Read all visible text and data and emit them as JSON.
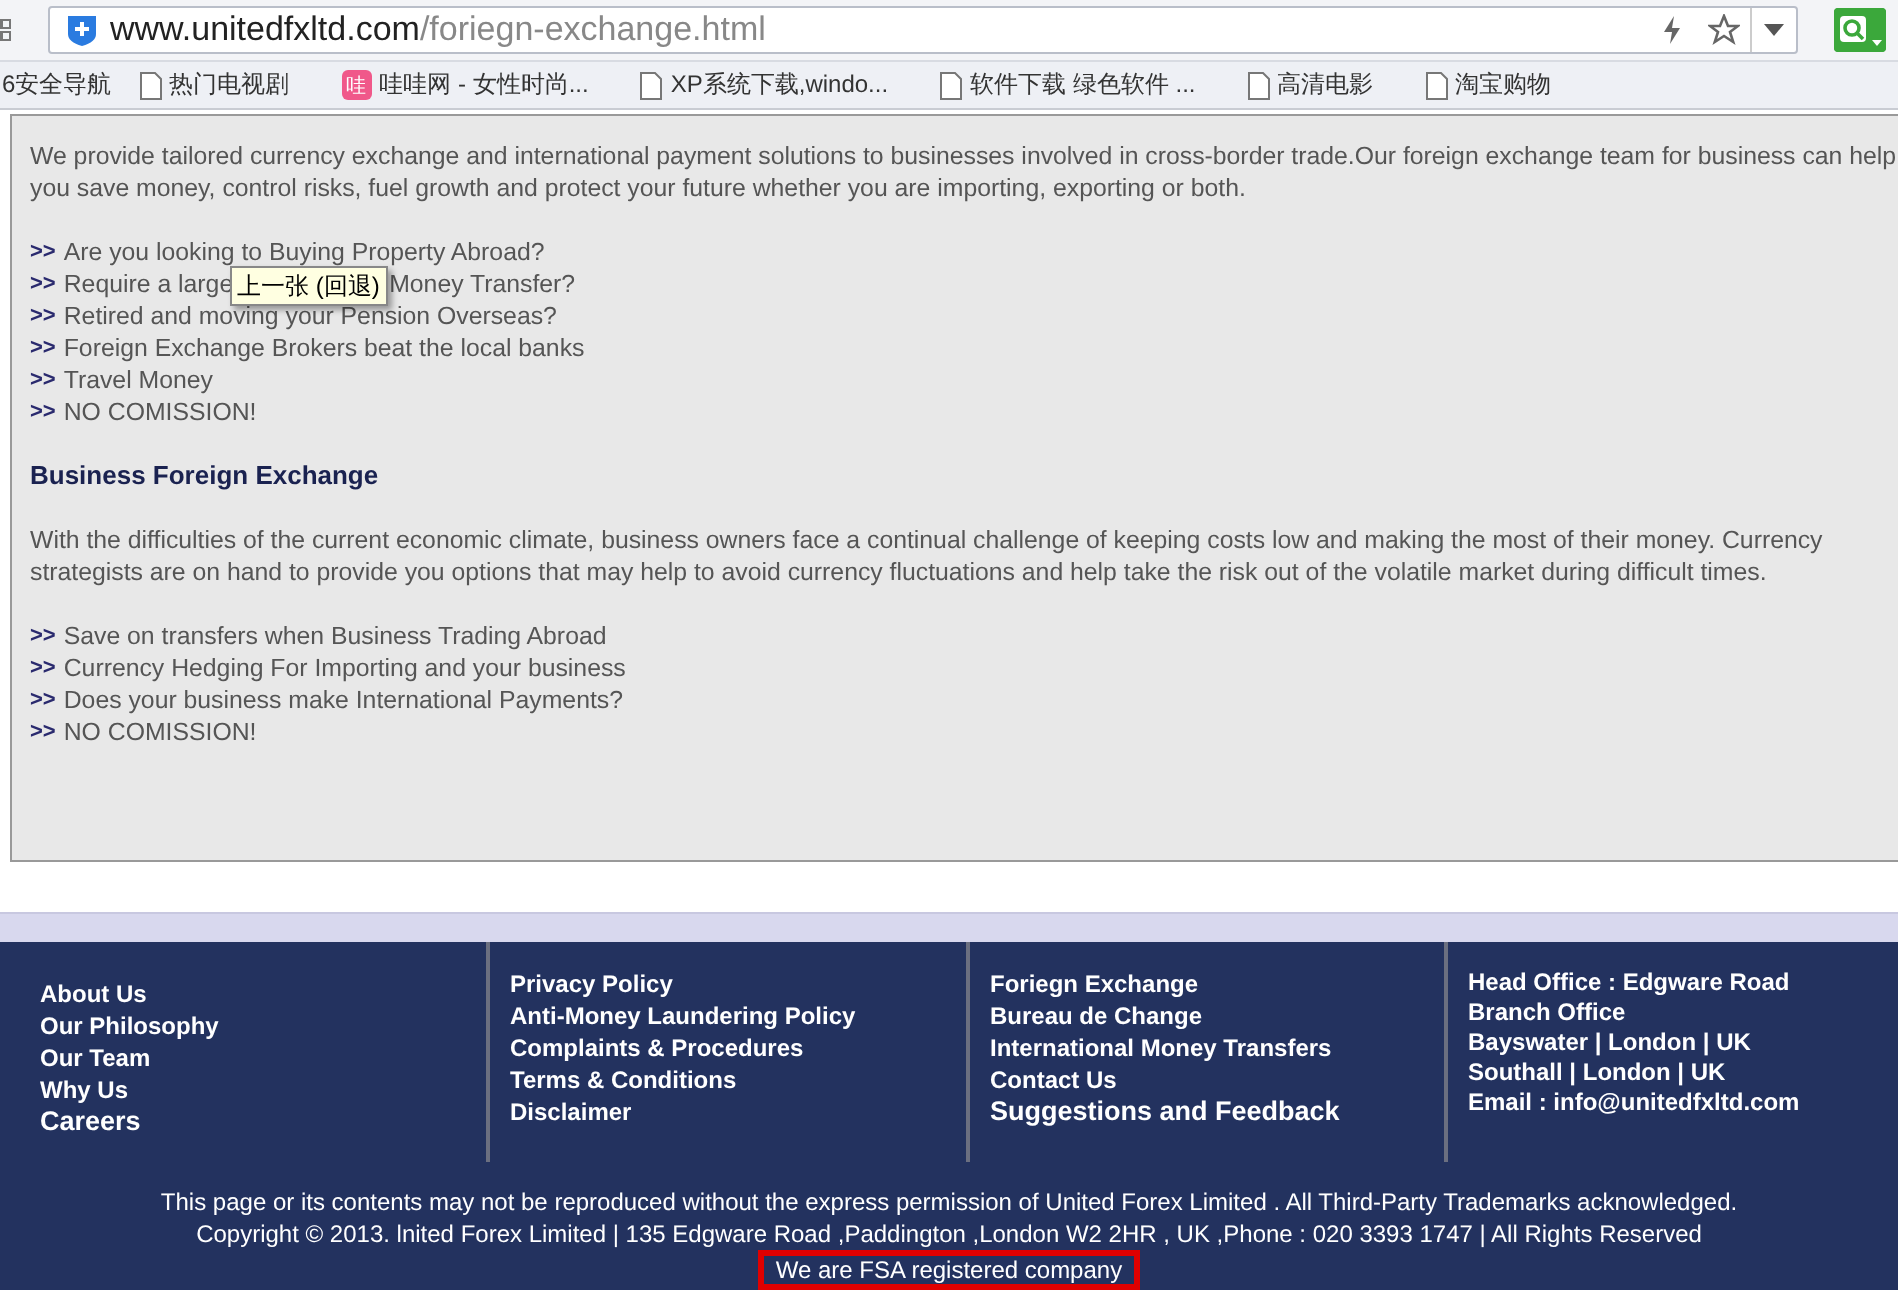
{
  "browser": {
    "url_host": "www.unitedfxltd.com",
    "url_path": "/foriegn-exchange.html",
    "bookmarks": [
      {
        "label": "6安全导航",
        "kind": "plain"
      },
      {
        "label": "热门电视剧",
        "kind": "page"
      },
      {
        "label": "哇哇网 - 女性时尚...",
        "kind": "badge",
        "badge": "哇"
      },
      {
        "label": "XP系统下载,windo...",
        "kind": "page"
      },
      {
        "label": "软件下载 绿色软件 ...",
        "kind": "page"
      },
      {
        "label": "高清电影",
        "kind": "page"
      },
      {
        "label": "淘宝购物",
        "kind": "page"
      }
    ]
  },
  "content": {
    "intro": "We provide tailored currency exchange and international payment solutions to businesses involved in cross-border trade.Our foreign exchange team for business can help you save money, control risks, fuel growth and protect your future whether you are importing, exporting or both.",
    "list_1": [
      {
        "bullet": ">>",
        "parts": [
          "Are you looking to Buying Property Abroad?"
        ]
      },
      {
        "bullet": ">>",
        "parts": [
          "Require a large",
          "Money Transfer?"
        ]
      },
      {
        "bullet": ">>",
        "parts": [
          "Retired and moving your Pension Overseas?"
        ]
      },
      {
        "bullet": ">>",
        "parts": [
          "Foreign Exchange Brokers beat the local banks"
        ]
      },
      {
        "bullet": ">>",
        "parts": [
          "Travel Money"
        ]
      },
      {
        "bullet": ">>",
        "parts": [
          "NO COMISSION!"
        ]
      }
    ],
    "heading": "Business Foreign Exchange",
    "body": "With the difficulties of the current economic climate, business owners face a continual challenge of keeping costs low and making the most of their money. Currency strategists are on hand to provide you options that may help to avoid currency fluctuations and help take the risk out of the volatile market during difficult times.",
    "list_2": [
      {
        "bullet": ">>",
        "parts": [
          "Save on transfers when Business Trading Abroad"
        ]
      },
      {
        "bullet": ">>",
        "parts": [
          "Currency Hedging For Importing and your business"
        ]
      },
      {
        "bullet": ">>",
        "parts": [
          "Does your business make International Payments?"
        ]
      },
      {
        "bullet": ">>",
        "parts": [
          "NO COMISSION!"
        ]
      }
    ]
  },
  "tooltip": {
    "text": "上一张 (回退)"
  },
  "footer": {
    "columns": [
      {
        "items": [
          {
            "text": "About Us",
            "kind": "link"
          },
          {
            "text": "Our Philosophy",
            "kind": "link"
          },
          {
            "text": "Our Team",
            "kind": "link"
          },
          {
            "text": "Why Us",
            "kind": "link"
          },
          {
            "text": "Careers",
            "kind": "large"
          }
        ]
      },
      {
        "items": [
          {
            "text": "Privacy Policy",
            "kind": "link"
          },
          {
            "text": "Anti-Money Laundering Policy",
            "kind": "link"
          },
          {
            "text": "Complaints & Procedures",
            "kind": "link"
          },
          {
            "text": "Terms & Conditions",
            "kind": "link"
          },
          {
            "text": "Disclaimer",
            "kind": "link"
          }
        ]
      },
      {
        "items": [
          {
            "text": "Foriegn Exchange",
            "kind": "link"
          },
          {
            "text": "Bureau de Change",
            "kind": "link"
          },
          {
            "text": "International Money Transfers",
            "kind": "link"
          },
          {
            "text": "Contact Us",
            "kind": "link"
          },
          {
            "text": "Suggestions and Feedback",
            "kind": "large"
          }
        ]
      },
      {
        "items": [
          {
            "text": "Head Office : Edgware Road",
            "kind": "info"
          },
          {
            "text": "Branch Office",
            "kind": "info"
          },
          {
            "text": "Bayswater | London | UK",
            "kind": "info"
          },
          {
            "text": "Southall | London | UK",
            "kind": "info"
          },
          {
            "text": "Email : info@unitedfxltd.com",
            "kind": "info"
          }
        ]
      }
    ],
    "notice": "This page or its contents may not be reproduced without the express permission of United Forex Limited . All Third-Party Trademarks acknowledged.",
    "copyright": "Copyright © 2013. lnited Forex Limited | 135 Edgware Road ,Paddington ,London W2 2HR , UK ,Phone : 020 3393 1747 | All Rights Reserved",
    "fsa": "We are FSA registered company"
  }
}
